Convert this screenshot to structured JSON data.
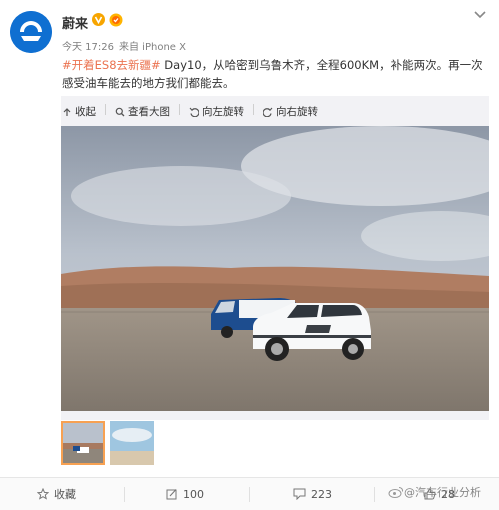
{
  "user": {
    "name": "蔚来",
    "avatar": "nio-logo"
  },
  "post": {
    "time": "今天 17:26",
    "source": "来自 iPhone X",
    "hashtag": "#开着ES8去新疆#",
    "text": " Day10，从哈密到乌鲁木齐，全程600KM，补能两次。再一次感受油车能去的地方我们都能去。"
  },
  "toolbar": [
    {
      "label": "收起",
      "icon": "collapse-icon"
    },
    {
      "label": "查看大图",
      "icon": "zoom-icon"
    },
    {
      "label": "向左旋转",
      "icon": "rotate-left-icon"
    },
    {
      "label": "向右旋转",
      "icon": "rotate-right-icon"
    }
  ],
  "photos": [
    {
      "desc": "desert-cars",
      "selected": true
    },
    {
      "desc": "sky-desert",
      "selected": false
    }
  ],
  "footer": {
    "favorite": "收藏",
    "repost": "100",
    "comment": "223",
    "like": "28"
  },
  "watermark": "@汽车行业分析",
  "colors": {
    "accent": "#eb7350",
    "avatar": "#0f6fd1",
    "vip": "#f7a500"
  }
}
